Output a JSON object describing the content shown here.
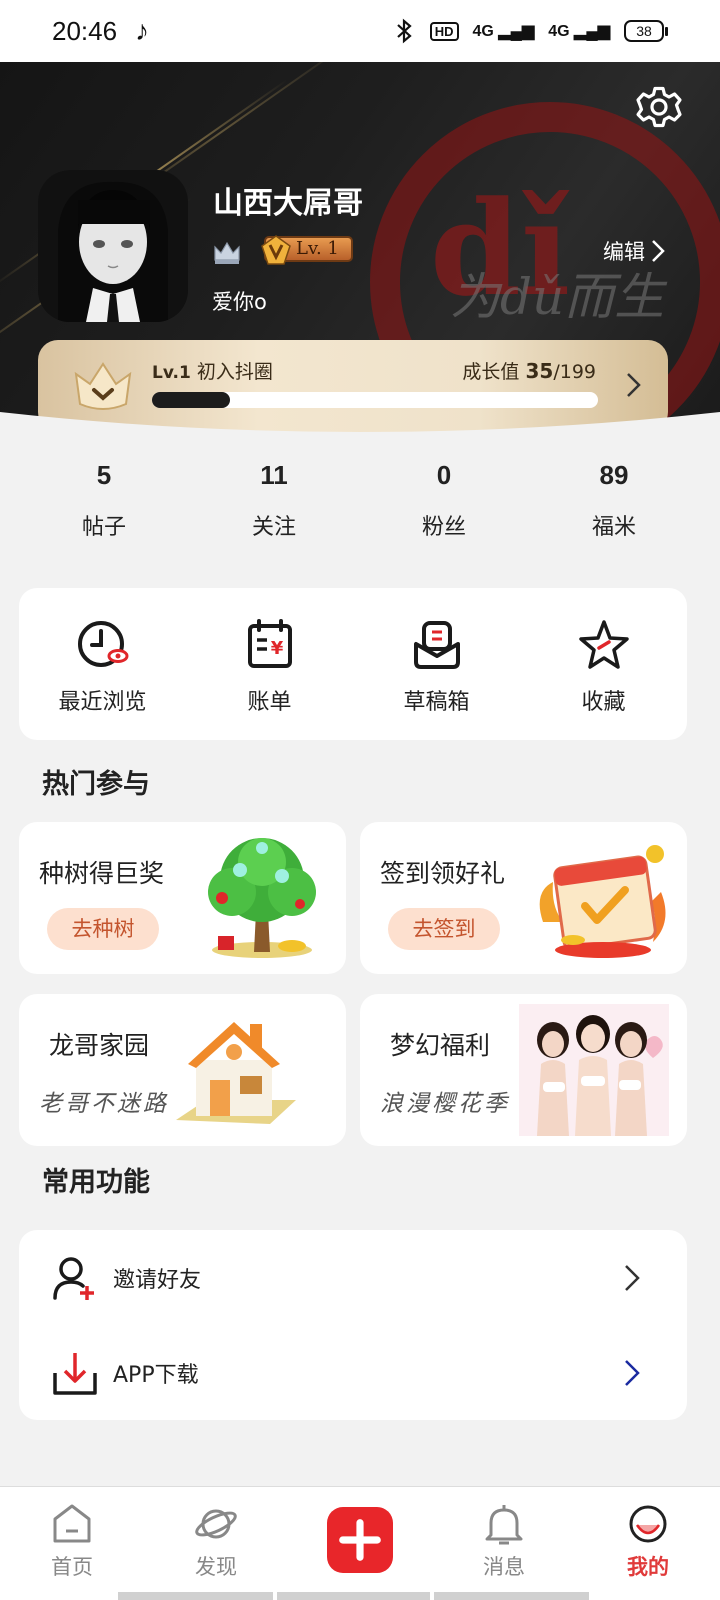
{
  "status_bar": {
    "time": "20:46",
    "network_label": "4G",
    "hd_label": "HD",
    "battery": "38"
  },
  "profile": {
    "username": "山西大屌哥",
    "level_badge": "Lv. 1",
    "bio": "爱你o",
    "edit_label": "编辑",
    "watermark": "dǐ",
    "watermark_script": "为dǔ而生"
  },
  "growth": {
    "level_code": "Lv.1",
    "level_name": "初入抖圈",
    "label": "成长值",
    "current": "35",
    "total": "/199",
    "progress_fraction": 0.176
  },
  "stats": [
    {
      "value": "5",
      "label": "帖子"
    },
    {
      "value": "11",
      "label": "关注"
    },
    {
      "value": "0",
      "label": "粉丝"
    },
    {
      "value": "89",
      "label": "福米"
    }
  ],
  "quick_actions": [
    {
      "label": "最近浏览",
      "icon": "clock-icon"
    },
    {
      "label": "账单",
      "icon": "bill-icon"
    },
    {
      "label": "草稿箱",
      "icon": "draft-box-icon"
    },
    {
      "label": "收藏",
      "icon": "star-icon"
    }
  ],
  "hot_section": {
    "title": "热门参与",
    "items": [
      {
        "title": "种树得巨奖",
        "button": "去种树",
        "image": "tree-illustration"
      },
      {
        "title": "签到领好礼",
        "button": "去签到",
        "image": "calendar-illustration"
      },
      {
        "title": "龙哥家园",
        "subtitle": "老哥不迷路",
        "image": "house-illustration"
      },
      {
        "title": "梦幻福利",
        "subtitle": "浪漫樱花季",
        "image": "girls-photo"
      }
    ]
  },
  "common_section": {
    "title": "常用功能",
    "items": [
      {
        "label": "邀请好友",
        "icon": "add-user-icon"
      },
      {
        "label": "APP下载",
        "icon": "download-icon"
      }
    ]
  },
  "tabs": [
    {
      "label": "首页",
      "icon": "home-icon"
    },
    {
      "label": "发现",
      "icon": "planet-icon"
    },
    {
      "label": "",
      "icon": "plus-icon"
    },
    {
      "label": "消息",
      "icon": "bell-icon"
    },
    {
      "label": "我的",
      "icon": "profile-face-icon",
      "active": true
    }
  ],
  "colors": {
    "accent": "#e8262a",
    "header_bg": "#1c1c1c",
    "gold": "#e8c9a0"
  }
}
